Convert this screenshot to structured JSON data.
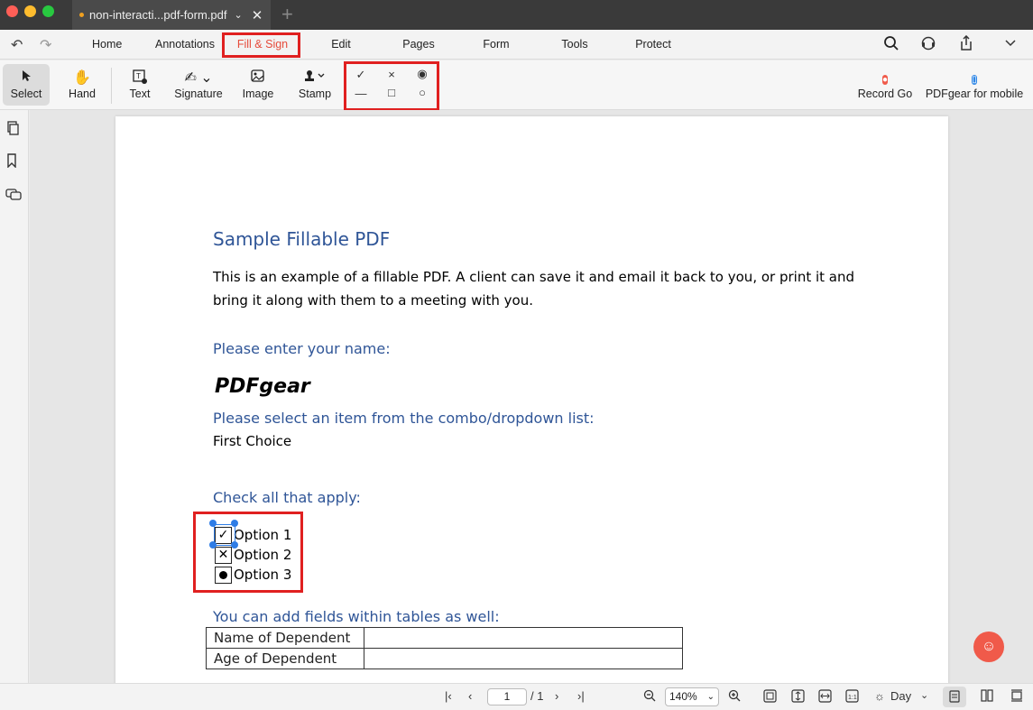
{
  "titlebar": {
    "tab_title": "non-interacti...pdf-form.pdf"
  },
  "menubar": {
    "items": [
      "Home",
      "Annotations",
      "Fill & Sign",
      "Edit",
      "Pages",
      "Form",
      "Tools",
      "Protect"
    ],
    "active": "Fill & Sign"
  },
  "toolbar": {
    "tools": [
      "Select",
      "Hand",
      "Text",
      "Signature",
      "Image",
      "Stamp"
    ],
    "right_tools": [
      "Record Go",
      "PDFgear for mobile"
    ],
    "shapes": [
      "✓",
      "×",
      "◉",
      "—",
      "□",
      "○"
    ]
  },
  "document": {
    "title": "Sample Fillable PDF",
    "intro_line1": "This is an example of a fillable PDF. A client can save it and email it back to you, or print it and",
    "intro_line2": "bring it along with them to a meeting with you.",
    "name_prompt": "Please enter your name:",
    "name_value": "PDFgear",
    "combo_prompt": "Please select an item from the combo/dropdown list:",
    "combo_value": "First Choice",
    "check_prompt": "Check all that apply:",
    "options": [
      {
        "label": "Option 1",
        "mark": "✓"
      },
      {
        "label": "Option 2",
        "mark": "✕"
      },
      {
        "label": "Option 3",
        "mark": "dot"
      }
    ],
    "table_prompt": "You can add  fields within tables as well:",
    "table_rows": [
      "Name of Dependent",
      "Age of Dependent"
    ]
  },
  "statusbar": {
    "page_current": "1",
    "page_total": "/ 1",
    "zoom": "140%",
    "theme": "Day"
  },
  "colors": {
    "accent": "#e64b3b",
    "heading": "#2f5597",
    "highlight": "#e02020",
    "selection": "#2f7de6"
  }
}
